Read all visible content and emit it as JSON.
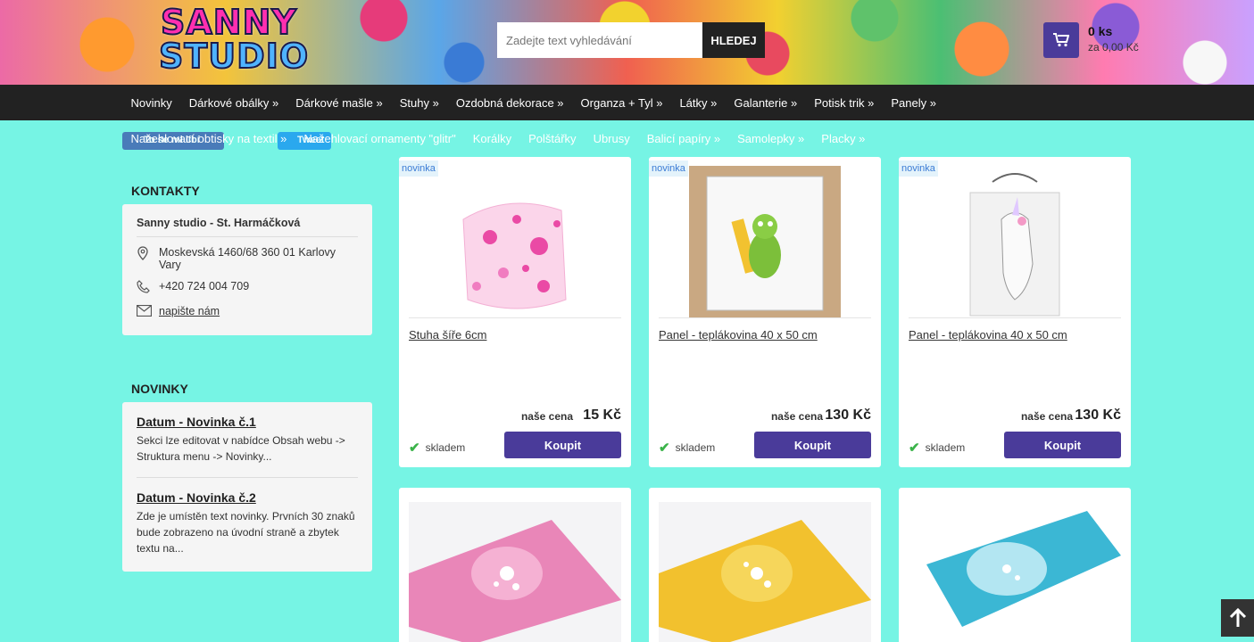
{
  "header": {
    "logo_line1": "SANNY",
    "logo_line2": "STUDIO",
    "search_placeholder": "Zadejte text vyhledávání",
    "search_button": "HLEDEJ",
    "cart_count": "0 ks",
    "cart_sum": "za 0,00 Kč"
  },
  "nav": {
    "row1": [
      "Novinky",
      "Dárkové obálky »",
      "Dárkové mašle »",
      "Stuhy »",
      "Ozdobná dekorace »",
      "Organza + Tyl »",
      "Látky »",
      "Galanterie »",
      "Potisk trik »",
      "Panely »"
    ],
    "row2": [
      "Nažehlovací obtisky na textil »",
      "Nažehlovací ornamenty \"glitr\"",
      "Korálky",
      "Polštářky",
      "Ubrusy",
      "Balicí papíry »",
      "Samolepky »",
      "Placky »"
    ]
  },
  "social": {
    "fb": "To se mi líbí",
    "tw": "Tweet"
  },
  "sidebar": {
    "contacts_title": "KONTAKTY",
    "contact_name": "Sanny studio - St. Harmáčková",
    "address": "Moskevská 1460/68 360 01 Karlovy Vary",
    "phone": "+420 724 004 709",
    "email_link": "napište nám",
    "news_title": "NOVINKY",
    "news": [
      {
        "title": "Datum - Novinka č.1",
        "text": "Sekci lze editovat v nabídce Obsah webu -> Struktura menu -> Novinky..."
      },
      {
        "title": "Datum - Novinka č.2",
        "text": "Zde je umístěn text novinky. Prvních 30 znaků bude zobrazeno na úvodní straně a zbytek textu na..."
      }
    ]
  },
  "products": [
    {
      "badge": "novinka",
      "name": "Stuha šíře 6cm",
      "price_label": "naše cena",
      "price": "15 Kč",
      "stock": "skladem",
      "buy": "Koupit"
    },
    {
      "badge": "novinka",
      "name": "Panel - teplákovina 40 x 50 cm",
      "price_label": "naše cena",
      "price": "130 Kč",
      "stock": "skladem",
      "buy": "Koupit"
    },
    {
      "badge": "novinka",
      "name": "Panel - teplákovina 40 x 50 cm",
      "price_label": "naše cena",
      "price": "130 Kč",
      "stock": "skladem",
      "buy": "Koupit"
    }
  ],
  "colors": {
    "background": "#76f4e4",
    "navbar": "#222222",
    "accent": "#4a3b9a",
    "stock_ok": "#3bb34a"
  }
}
